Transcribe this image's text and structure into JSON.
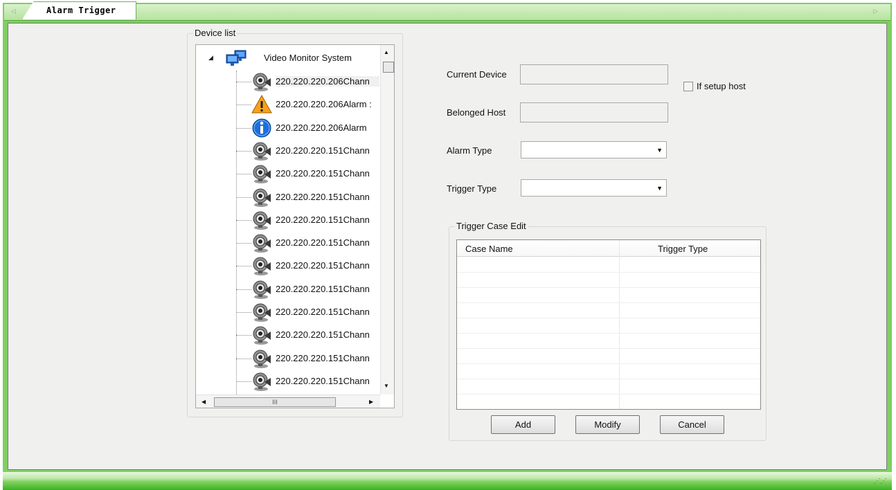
{
  "tab": {
    "label": "Alarm Trigger"
  },
  "device_list": {
    "title": "Device list",
    "root": {
      "label": "Video Monitor System",
      "icon": "network-computers-icon"
    },
    "items": [
      {
        "label": "220.220.220.206Chann",
        "icon": "camera-icon"
      },
      {
        "label": "220.220.220.206Alarm :",
        "icon": "warning-icon"
      },
      {
        "label": "220.220.220.206Alarm ",
        "icon": "info-icon"
      },
      {
        "label": "220.220.220.151Chann",
        "icon": "camera-icon"
      },
      {
        "label": "220.220.220.151Chann",
        "icon": "camera-icon"
      },
      {
        "label": "220.220.220.151Chann",
        "icon": "camera-icon"
      },
      {
        "label": "220.220.220.151Chann",
        "icon": "camera-icon"
      },
      {
        "label": "220.220.220.151Chann",
        "icon": "camera-icon"
      },
      {
        "label": "220.220.220.151Chann",
        "icon": "camera-icon"
      },
      {
        "label": "220.220.220.151Chann",
        "icon": "camera-icon"
      },
      {
        "label": "220.220.220.151Chann",
        "icon": "camera-icon"
      },
      {
        "label": "220.220.220.151Chann",
        "icon": "camera-icon"
      },
      {
        "label": "220.220.220.151Chann",
        "icon": "camera-icon"
      },
      {
        "label": "220.220.220.151Chann",
        "icon": "camera-icon"
      }
    ],
    "hscroll_thumb": "III"
  },
  "form": {
    "current_device_label": "Current Device",
    "current_device_value": "",
    "belonged_host_label": "Belonged Host",
    "belonged_host_value": "",
    "if_setup_host_label": "If setup host",
    "if_setup_host_checked": false,
    "alarm_type_label": "Alarm Type",
    "alarm_type_value": "",
    "trigger_type_label": "Trigger Type",
    "trigger_type_value": ""
  },
  "trigger_case": {
    "title": "Trigger Case Edit",
    "columns": [
      "Case Name",
      "Trigger Type"
    ],
    "rows": [],
    "buttons": {
      "add": "Add",
      "modify": "Modify",
      "cancel": "Cancel"
    }
  }
}
